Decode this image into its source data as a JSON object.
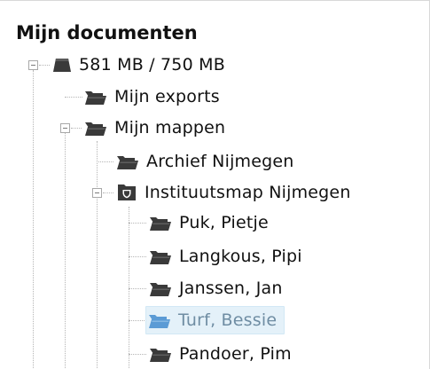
{
  "panel": {
    "title": "Mijn documenten"
  },
  "tree": {
    "storage": {
      "label": "581 MB / 750 MB",
      "icon": "database-icon"
    },
    "exports": {
      "label": "Mijn exports",
      "icon": "folder-icon"
    },
    "folders": {
      "label": "Mijn mappen",
      "icon": "folder-icon",
      "archive": {
        "label": "Archief Nijmegen",
        "icon": "folder-icon"
      },
      "institute": {
        "label": "Instituutsmap Nijmegen",
        "icon": "shared-folder-icon",
        "children": [
          {
            "label": "Puk, Pietje",
            "icon": "folder-icon"
          },
          {
            "label": "Langkous, Pipi",
            "icon": "folder-icon"
          },
          {
            "label": "Janssen, Jan",
            "icon": "folder-icon"
          },
          {
            "label": "Turf, Bessie",
            "icon": "folder-icon",
            "selected": true
          },
          {
            "label": "Pandoer, Pim",
            "icon": "folder-icon"
          }
        ]
      }
    }
  },
  "colors": {
    "folder_dark": "#3a3a3a",
    "folder_selected": "#5b9bd5",
    "selected_bg": "#e4f1f9",
    "selected_text": "#6f8da3"
  }
}
